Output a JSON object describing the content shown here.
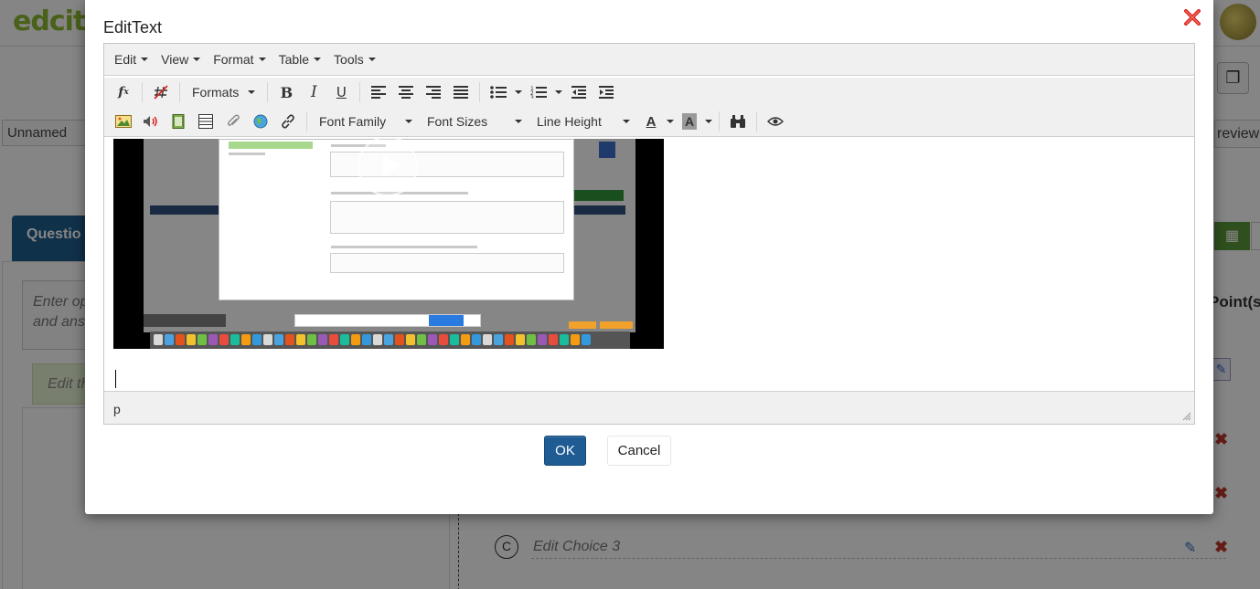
{
  "background": {
    "logo": "edcite",
    "assignment_name": "Unnamed",
    "preview_label": "review",
    "question_tab": "Questio",
    "enter_prompt": "Enter op and ans",
    "edit_green_text": "Edit th",
    "points_header": "Point(s)",
    "choice_letter": "C",
    "choice_text": "Edit Choice 3"
  },
  "modal": {
    "title": "EditText",
    "close_icon": "close-x-icon",
    "ok_label": "OK",
    "cancel_label": "Cancel"
  },
  "menubar": {
    "items": [
      {
        "label": "Edit"
      },
      {
        "label": "View"
      },
      {
        "label": "Format"
      },
      {
        "label": "Table"
      },
      {
        "label": "Tools"
      }
    ]
  },
  "toolbar": {
    "formats_label": "Formats",
    "bold": "B",
    "italic": "I",
    "underline": "U",
    "font_family_label": "Font Family",
    "font_sizes_label": "Font Sizes",
    "line_height_label": "Line Height",
    "text_color_letter": "A",
    "bg_color_letter": "A"
  },
  "statusbar": {
    "path": "p"
  },
  "colors": {
    "primary": "#1f5c94",
    "close_red": "#d9231e",
    "toolbar_bg": "#f0f0f0"
  }
}
